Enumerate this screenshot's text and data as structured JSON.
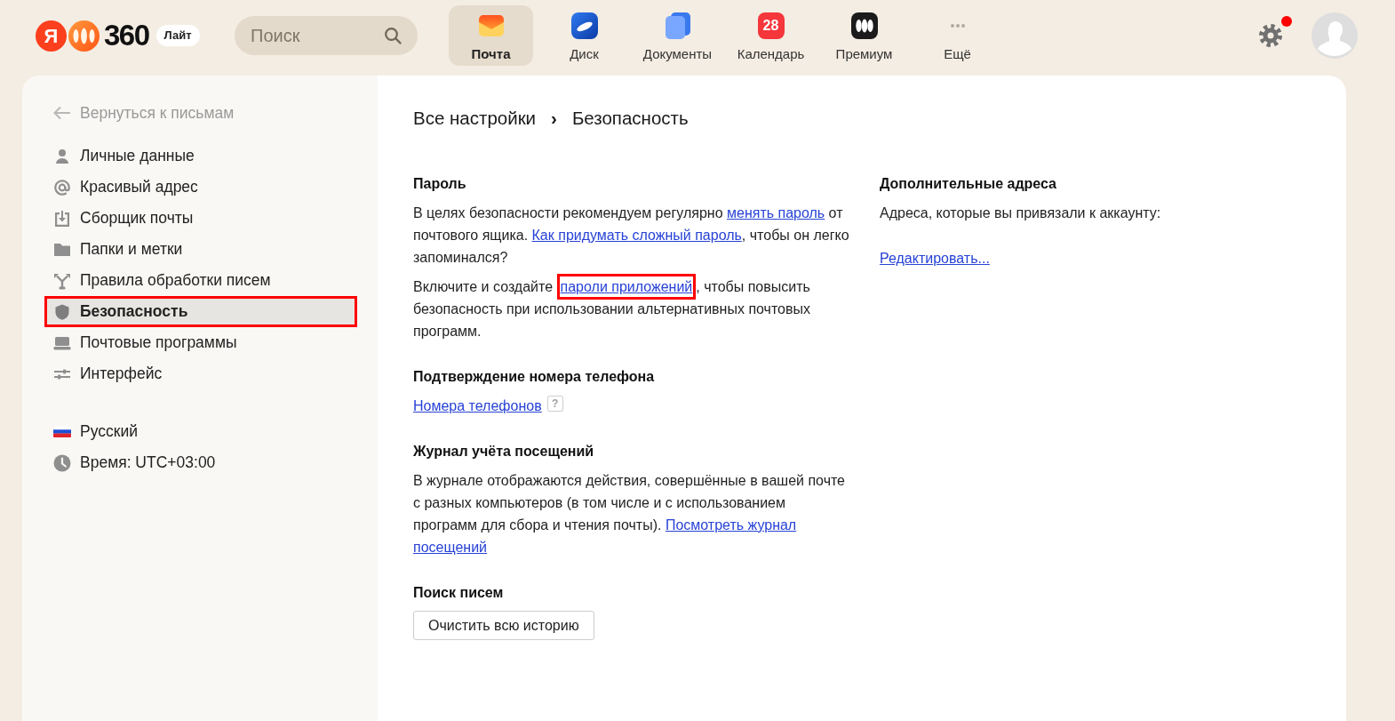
{
  "header": {
    "logo": {
      "letter": "Я",
      "name": "360",
      "badge": "Лайт"
    },
    "search": {
      "placeholder": "Поиск"
    },
    "apps": [
      {
        "label": "Почта",
        "selected": true
      },
      {
        "label": "Диск",
        "selected": false
      },
      {
        "label": "Документы",
        "selected": false
      },
      {
        "label": "Календарь",
        "selected": false,
        "icon_text": "28"
      },
      {
        "label": "Премиум",
        "selected": false
      },
      {
        "label": "Ещё",
        "selected": false
      }
    ],
    "settings": {
      "notification": true
    }
  },
  "sidebar": {
    "back_link": "Вернуться к письмам",
    "items": [
      {
        "label": "Личные данные",
        "selected": false,
        "highlighted": false
      },
      {
        "label": "Красивый адрес",
        "selected": false,
        "highlighted": false
      },
      {
        "label": "Сборщик почты",
        "selected": false,
        "highlighted": false
      },
      {
        "label": "Папки и метки",
        "selected": false,
        "highlighted": false
      },
      {
        "label": "Правила обработки писем",
        "selected": false,
        "highlighted": false
      },
      {
        "label": "Безопасность",
        "selected": true,
        "highlighted": true
      },
      {
        "label": "Почтовые программы",
        "selected": false,
        "highlighted": false
      },
      {
        "label": "Интерфейс",
        "selected": false,
        "highlighted": false
      }
    ],
    "preferences": [
      {
        "label": "Русский"
      },
      {
        "label": "Время: UTC+03:00"
      }
    ]
  },
  "breadcrumbs": {
    "items": [
      "Все настройки",
      "Безопасность"
    ],
    "separator": "›"
  },
  "columns": [
    {
      "sections": [
        {
          "title": "Пароль",
          "blocks": [
            {
              "kind": "paragraph",
              "parts": [
                {
                  "kind": "text",
                  "text": "В целях безопасности рекомендуем регулярно "
                },
                {
                  "kind": "link",
                  "text": "менять пароль",
                  "highlighted": false
                },
                {
                  "kind": "text",
                  "text": " от почтового ящика. "
                },
                {
                  "kind": "link",
                  "text": "Как придумать сложный пароль",
                  "highlighted": false
                },
                {
                  "kind": "text",
                  "text": ", чтобы он легко запоминался?"
                }
              ]
            },
            {
              "kind": "paragraph",
              "parts": [
                {
                  "kind": "text",
                  "text": "Включите и создайте "
                },
                {
                  "kind": "link",
                  "text": "пароли приложений",
                  "highlighted": true
                },
                {
                  "kind": "text",
                  "text": ", чтобы повысить безопасность при использовании альтернативных почтовых программ."
                }
              ]
            }
          ]
        },
        {
          "title": "Подтверждение номера телефона",
          "blocks": [
            {
              "kind": "paragraph",
              "parts": [
                {
                  "kind": "link",
                  "text": "Номера телефонов",
                  "highlighted": false
                },
                {
                  "kind": "help",
                  "text": "?"
                }
              ]
            }
          ]
        },
        {
          "title": "Журнал учёта посещений",
          "blocks": [
            {
              "kind": "paragraph",
              "parts": [
                {
                  "kind": "text",
                  "text": "В журнале отображаются действия, совершённые в вашей почте с разных компьютеров (в том числе и с использованием"
                },
                {
                  "kind": "break"
                },
                {
                  "kind": "text",
                  "text": "программ для сбора и чтения почты). "
                },
                {
                  "kind": "link",
                  "text": "Посмотреть журнал",
                  "highlighted": false
                },
                {
                  "kind": "link",
                  "text": "посещений",
                  "highlighted": false
                }
              ]
            }
          ]
        },
        {
          "title": "Поиск писем",
          "blocks": [
            {
              "kind": "button",
              "label": "Очистить всю историю"
            }
          ]
        }
      ]
    },
    {
      "sections": [
        {
          "title": "Дополнительные адреса",
          "blocks": [
            {
              "kind": "paragraph",
              "parts": [
                {
                  "kind": "text",
                  "text": "Адреса, которые вы привязали к аккаунту:"
                }
              ]
            },
            {
              "kind": "link",
              "text": "Редактировать...",
              "highlighted": false
            }
          ]
        }
      ]
    }
  ]
}
